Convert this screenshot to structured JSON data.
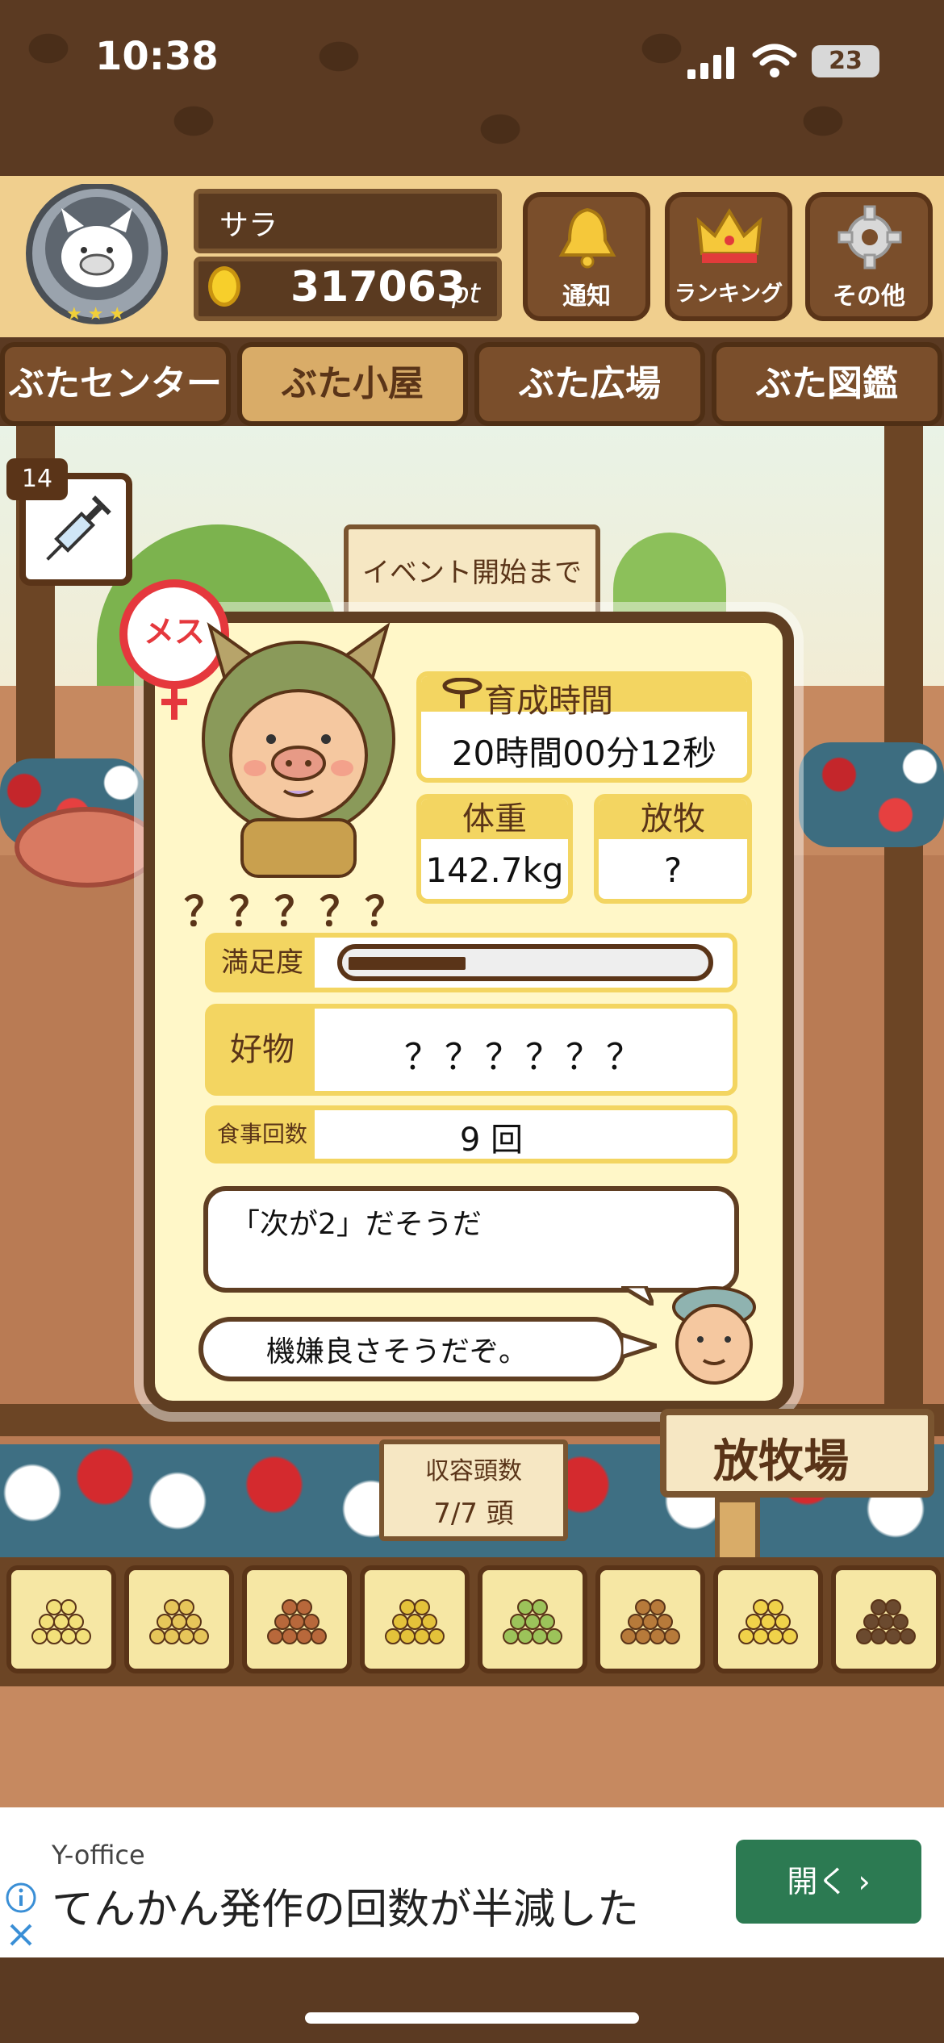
{
  "status_bar": {
    "time": "10:38",
    "battery": "23",
    "icons": [
      "signal-icon",
      "wifi-icon",
      "battery-icon"
    ]
  },
  "header": {
    "player_name": "サラ",
    "points": "317063",
    "points_unit": "pt",
    "buttons": [
      {
        "label": "通知",
        "icon": "bell-icon"
      },
      {
        "label": "ランキング",
        "icon": "crown-icon"
      },
      {
        "label": "その他",
        "icon": "gear-icon"
      }
    ]
  },
  "nav": {
    "tabs": [
      {
        "label": "ぶたセンター",
        "active": false
      },
      {
        "label": "ぶた小屋",
        "active": true
      },
      {
        "label": "ぶた広場",
        "active": false
      },
      {
        "label": "ぶた図鑑",
        "active": false
      }
    ]
  },
  "scene": {
    "vaccine_count": "14",
    "event_sign": "イベント開始まで"
  },
  "pig_card": {
    "gender": "メス",
    "name": "？？？？？",
    "growth_time_label": "育成時間",
    "growth_time_value": "20時間00分12秒",
    "weight_label": "体重",
    "weight_value": "142.7kg",
    "graze_label": "放牧",
    "graze_value": "?",
    "satisfaction_label": "満足度",
    "satisfaction_level": 0.33,
    "favorite_label": "好物",
    "favorite_value": "？？？？？？",
    "meals_label": "食事回数",
    "meals_value": "9 回",
    "speech_1": "「次が2」だそうだ",
    "speech_2": "機嫌良さそうだぞ。"
  },
  "farm": {
    "capacity_title": "収容頭数",
    "capacity_value": "7/7 頭",
    "graze_sign": "放牧場"
  },
  "feed_bar": {
    "items": [
      "beans-icon",
      "grain-icon",
      "sweet-potato-icon",
      "corn-icon",
      "herb-icon",
      "acorn-icon",
      "bowl-feed-icon",
      "plate-feed-icon"
    ]
  },
  "ad": {
    "sponsor": "Y-office",
    "headline": "てんかん発作の回数が半減した",
    "open_label": "開く ›"
  },
  "colors": {
    "wood_dark": "#5a3418",
    "card_bg": "#fff7c8",
    "accent_yellow": "#f3d561",
    "female_red": "#e5383d",
    "ad_button": "#2c7a52"
  }
}
